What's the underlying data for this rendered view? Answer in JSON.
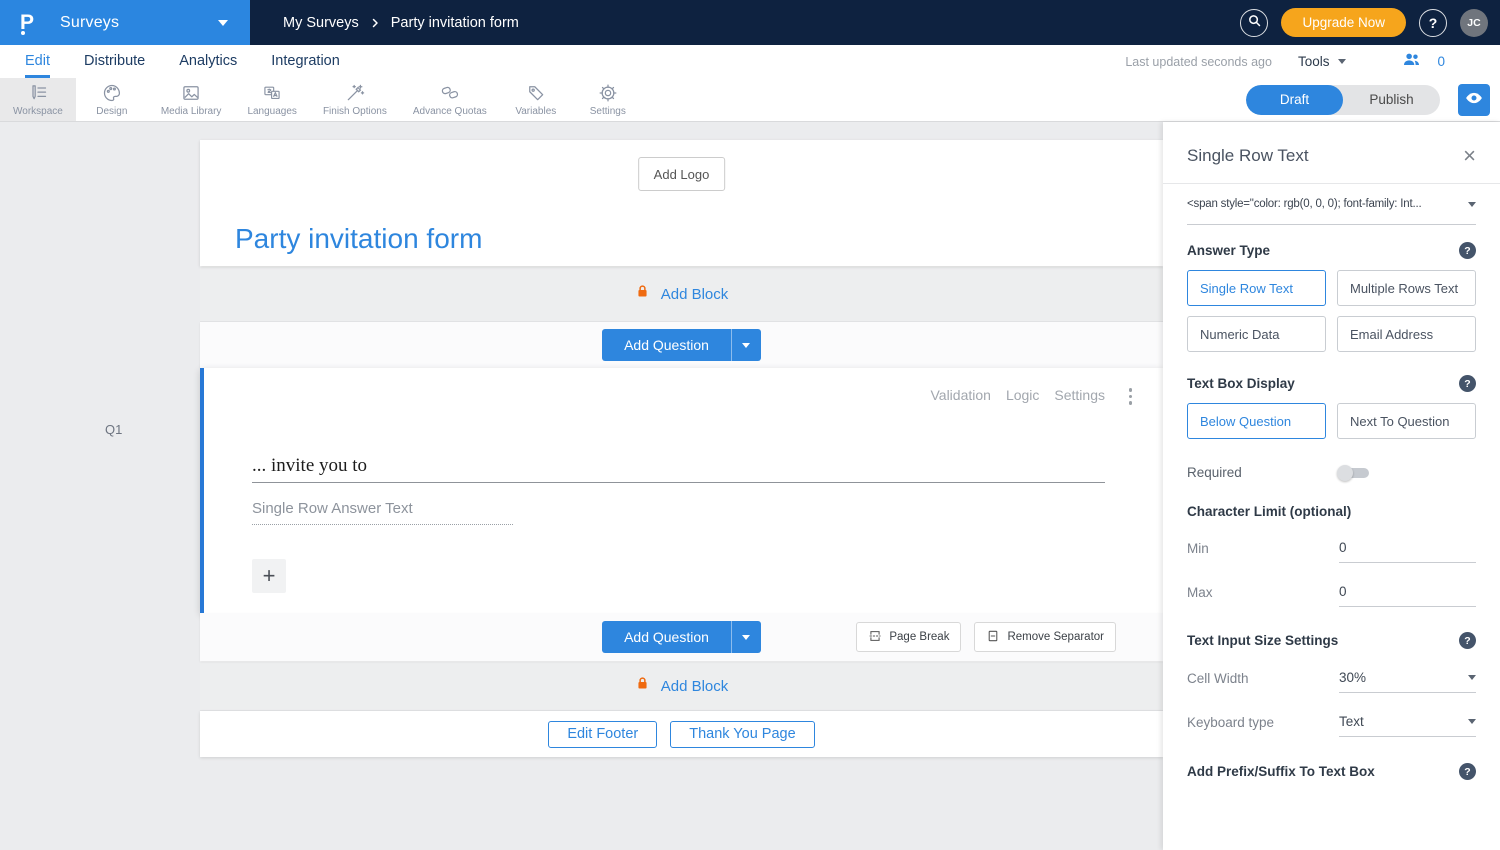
{
  "colors": {
    "accent_blue": "#2e86de",
    "navbar_navy": "#0e2240",
    "brand_blue": "#2b86e0",
    "upgrade_orange": "#f6a51c",
    "lock_orange": "#ef6a10"
  },
  "navbar": {
    "product": "Surveys",
    "breadcrumb": {
      "parent": "My Surveys",
      "current": "Party invitation form"
    },
    "upgrade": "Upgrade Now",
    "avatar": "JC"
  },
  "menubar": {
    "tabs": [
      {
        "label": "Edit"
      },
      {
        "label": "Distribute"
      },
      {
        "label": "Analytics"
      },
      {
        "label": "Integration"
      }
    ],
    "last_updated": "Last updated seconds ago",
    "tools": "Tools",
    "collaborator_count": "0"
  },
  "toolbar": {
    "items": [
      {
        "label": "Workspace"
      },
      {
        "label": "Design"
      },
      {
        "label": "Media Library"
      },
      {
        "label": "Languages"
      },
      {
        "label": "Finish Options"
      },
      {
        "label": "Advance Quotas"
      },
      {
        "label": "Variables"
      },
      {
        "label": "Settings"
      }
    ],
    "draft": "Draft",
    "publish": "Publish"
  },
  "canvas": {
    "add_logo": "Add Logo",
    "title": "Party invitation form",
    "add_block": "Add Block",
    "add_question": "Add Question",
    "question": {
      "id": "Q1",
      "menu": [
        "Validation",
        "Logic",
        "Settings"
      ],
      "text": "... invite you to",
      "answer_placeholder": "Single Row Answer Text",
      "add_symbol": "+"
    },
    "page_break": "Page Break",
    "remove_separator": "Remove Separator",
    "edit_footer": "Edit Footer",
    "thank_you": "Thank You Page"
  },
  "panel": {
    "title": "Single Row Text",
    "close": "×",
    "style_dropdown_value": "<span style=\"color: rgb(0, 0, 0); font-family: Int...",
    "answer_type": {
      "heading": "Answer Type",
      "options": [
        {
          "label": "Single Row Text",
          "selected": true
        },
        {
          "label": "Multiple Rows Text",
          "selected": false
        },
        {
          "label": "Numeric Data",
          "selected": false
        },
        {
          "label": "Email Address",
          "selected": false
        }
      ]
    },
    "text_box_display": {
      "heading": "Text Box Display",
      "options": [
        {
          "label": "Below Question",
          "selected": true
        },
        {
          "label": "Next To Question",
          "selected": false
        }
      ]
    },
    "required_label": "Required",
    "character_limit": {
      "heading": "Character Limit (optional)",
      "min_label": "Min",
      "min_value": "0",
      "max_label": "Max",
      "max_value": "0"
    },
    "input_size": {
      "heading": "Text Input Size Settings",
      "cell_width_label": "Cell Width",
      "cell_width_value": "30%",
      "keyboard_label": "Keyboard type",
      "keyboard_value": "Text"
    },
    "prefix_suffix_heading": "Add Prefix/Suffix To Text Box"
  }
}
